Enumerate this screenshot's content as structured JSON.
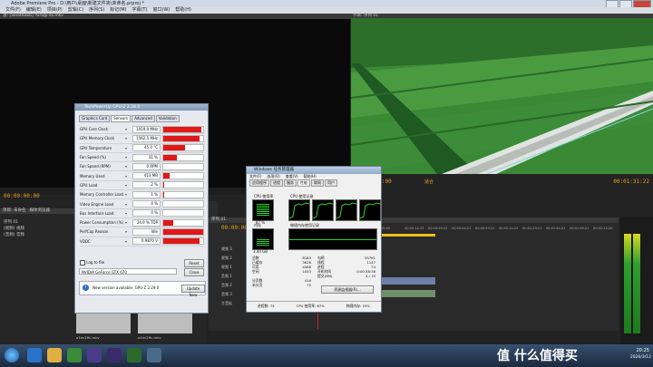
{
  "window": {
    "title": "Adobe Premiere Pro - D:\\用户\\桌面\\新建文件夹\\未命名.prproj *",
    "menu": [
      "文件(F)",
      "编辑(E)",
      "项目(P)",
      "剪辑(C)",
      "序列(S)",
      "标记(M)",
      "字幕(T)",
      "窗口(W)",
      "帮助(H)"
    ]
  },
  "source_panel": {
    "title": "源: [SeedRaws] Yuragi-so.mkv",
    "timecode": "00:00:00:00"
  },
  "program_panel": {
    "title": "节目: 序列 01",
    "timecode_left": "00:00:00:00",
    "timecode_right": "00:01:31:22",
    "fit": "适合"
  },
  "project_panel": {
    "tabs": [
      "项目: 未命名",
      "媒体浏览器",
      "信息",
      "效果"
    ],
    "items": [
      "序列 01",
      "(视频) 视频",
      "(音频) 音频"
    ],
    "thumb_labels": [
      "a1ec2ffc.mkv",
      "a1ec2ffc.mkv"
    ]
  },
  "gpuz": {
    "title": "TechPowerUp GPU-Z 2.28.0",
    "tabs": [
      "Graphics Card",
      "Sensors",
      "Advanced",
      "Validation"
    ],
    "active_tab": "Sensors",
    "sensors": [
      {
        "name": "GPU Core Clock",
        "value": "1019.0 MHz",
        "level": 0.95
      },
      {
        "name": "GPU Memory Clock",
        "value": "1562.5 MHz",
        "level": 0.9
      },
      {
        "name": "GPU Temperature",
        "value": "45.0 °C",
        "level": 0.55
      },
      {
        "name": "Fan Speed (%)",
        "value": "31 %",
        "level": 0.35
      },
      {
        "name": "Fan Speed (RPM)",
        "value": "0 RPM",
        "level": 0.0
      },
      {
        "name": "Memory Used",
        "value": "413 MB",
        "level": 0.15
      },
      {
        "name": "GPU Load",
        "value": "2 %",
        "level": 0.03
      },
      {
        "name": "Memory Controller Load",
        "value": "1 %",
        "level": 0.02
      },
      {
        "name": "Video Engine Load",
        "value": "0 %",
        "level": 0.0
      },
      {
        "name": "Bus Interface Load",
        "value": "0 %",
        "level": 0.0
      },
      {
        "name": "Power Consumption (%)",
        "value": "24.9 % TDP",
        "level": 0.25
      },
      {
        "name": "PerfCap Reason",
        "value": "Idle",
        "level": 1.0
      },
      {
        "name": "VDDC",
        "value": "0.9870 V",
        "level": 0.9
      }
    ],
    "log_label": "Log to file",
    "reset_label": "Reset",
    "gpu_name": "NVIDIA GeForce GTX 670",
    "close_label": "Close",
    "update_text": "New version available: GPU-Z 2.29.0",
    "update_button": "Update Now"
  },
  "taskmgr": {
    "title": "Windows 任务管理器",
    "menu": [
      "文件(F)",
      "选项(O)",
      "查看(V)",
      "帮助(H)"
    ],
    "tabs": [
      "应用程序",
      "进程",
      "服务",
      "性能",
      "联网",
      "用户"
    ],
    "active_tab": "性能",
    "cpu_usage_label": "CPU 使用率",
    "cpu_usage_value": "87 %",
    "cpu_history_label": "CPU 使用记录",
    "mem_label": "内存",
    "mem_value": "3.44 GB",
    "mem_history_label": "物理内存使用记录",
    "physical_mem": [
      [
        "总数",
        "8183"
      ],
      [
        "已缓存",
        "3626"
      ],
      [
        "可用",
        "4568"
      ],
      [
        "空闲",
        "1053"
      ]
    ],
    "system": [
      [
        "句柄",
        "35761"
      ],
      [
        "线程",
        "1147"
      ],
      [
        "进程",
        "74"
      ],
      [
        "开机时间",
        "0:00:38:38"
      ],
      [
        "提交(MB)",
        "4 / 15"
      ]
    ],
    "kernel_mem": [
      [
        "分页数",
        "416"
      ],
      [
        "未分页",
        "75"
      ]
    ],
    "resource_monitor_btn": "资源监视器(R)...",
    "status_processes": "进程数: 74",
    "status_cpu": "CPU 使用率: 87%",
    "status_mem": "物理内存: 23%"
  },
  "timeline": {
    "tabs": [
      "序列 01"
    ],
    "timecode": "00:00:00:00",
    "ruler": [
      "00:00",
      "00:00:14:23",
      "00:00:29:23",
      "00:00:44:22",
      "00:00:59:22",
      "00:01:14:22",
      "00:01:29:21",
      "00:01:44:21",
      "00:01:59:21",
      "00:02:14:20"
    ],
    "tracks": [
      "视频 3",
      "视频 2",
      "视频 1",
      "音频 1",
      "音频 2",
      "音频 3",
      "主音轨"
    ],
    "clip_labels": [
      "a1ec2ffc.mkv [视] 透明度:透明度",
      "a1ec2ffc.mkv [音]"
    ]
  },
  "taskbar": {
    "clock_time": "20:25",
    "clock_date": "2020/3/12",
    "watermark": "值 什么值得买"
  },
  "colors": {
    "accent": "#e8a020",
    "sensor_bar": "#e01818",
    "video_green": "#2f7d2c"
  }
}
